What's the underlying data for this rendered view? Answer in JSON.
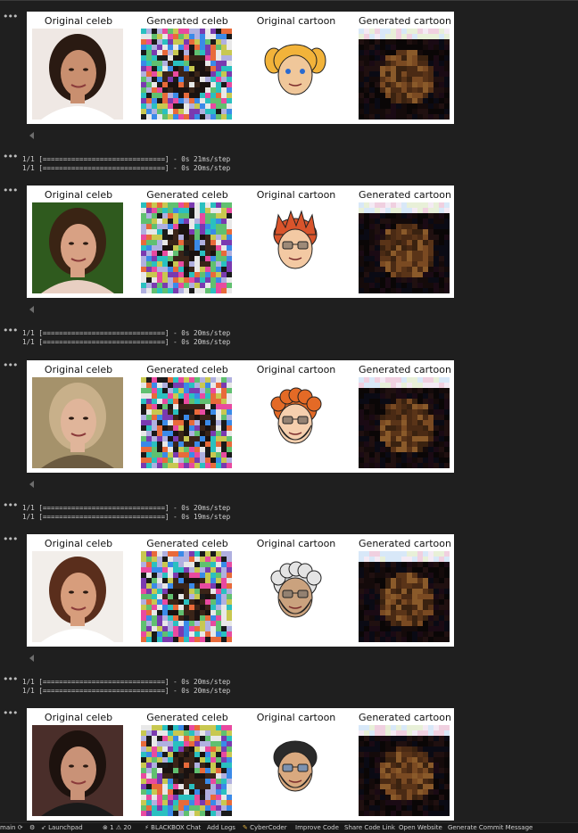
{
  "panel_titles": [
    "Original celeb",
    "Generated celeb",
    "Original cartoon",
    "Generated cartoon"
  ],
  "cells": [
    {
      "celeb": {
        "bg": "#efe8e4",
        "hair": "#2a1a12",
        "skin": "#c98f6f",
        "shirt": "#ffffff"
      },
      "cartoon": {
        "hair": "#f2b33a",
        "skin": "#f0c79a",
        "glasses": false,
        "beard": false,
        "style": "pigtails"
      },
      "logs": []
    },
    {
      "celeb": {
        "bg": "#2f5a1e",
        "hair": "#3a2414",
        "skin": "#d8a184",
        "shirt": "#e8cfc2"
      },
      "cartoon": {
        "hair": "#d9542b",
        "skin": "#f3c9a3",
        "glasses": true,
        "glass_color": "#555555",
        "beard": false,
        "style": "spiky"
      },
      "logs": [
        "1/1 [==============================] - 0s 21ms/step",
        "1/1 [==============================] - 0s 20ms/step"
      ]
    },
    {
      "celeb": {
        "bg": "#a5926b",
        "hair": "#c8b08a",
        "skin": "#e0b59a",
        "shirt": "#6b5a40"
      },
      "cartoon": {
        "hair": "#e46a26",
        "skin": "#f5cfae",
        "glasses": true,
        "glass_color": "#444444",
        "beard": true,
        "beard_color": "#e46a26",
        "style": "curly"
      },
      "logs": [
        "1/1 [==============================] - 0s 20ms/step",
        "1/1 [==============================] - 0s 20ms/step"
      ]
    },
    {
      "celeb": {
        "bg": "#f2eeea",
        "hair": "#5a2e1c",
        "skin": "#d79d7c",
        "shirt": "#ffffff"
      },
      "cartoon": {
        "hair": "#e4e4e4",
        "skin": "#caa27e",
        "glasses": true,
        "glass_color": "#666666",
        "beard": true,
        "beard_color": "#dcdcdc",
        "style": "curly"
      },
      "logs": [
        "1/1 [==============================] - 0s 20ms/step",
        "1/1 [==============================] - 0s 19ms/step"
      ]
    },
    {
      "celeb": {
        "bg": "#4a2e2a",
        "hair": "#1d120e",
        "skin": "#c99277",
        "shirt": "#1a1a1a"
      },
      "cartoon": {
        "hair": "#2a2a2a",
        "skin": "#d9a97f",
        "glasses": true,
        "glass_color": "#2f7fd8",
        "beard": true,
        "beard_color": "#3a2a20",
        "style": "short"
      },
      "logs": [
        "1/1 [==============================] - 0s 20ms/step",
        "1/1 [==============================] - 0s 20ms/step"
      ]
    }
  ],
  "status_bar": {
    "branch": "main",
    "launchpad": "Launchpad",
    "errors": "1",
    "warnings": "20",
    "blackbox": "BLACKBOX Chat",
    "add_logs": "Add Logs",
    "cybercoder": "CyberCoder",
    "improve": "Improve Code",
    "share": "Share Code Link",
    "open_site": "Open Website",
    "commit": "Generate Commit Message"
  }
}
